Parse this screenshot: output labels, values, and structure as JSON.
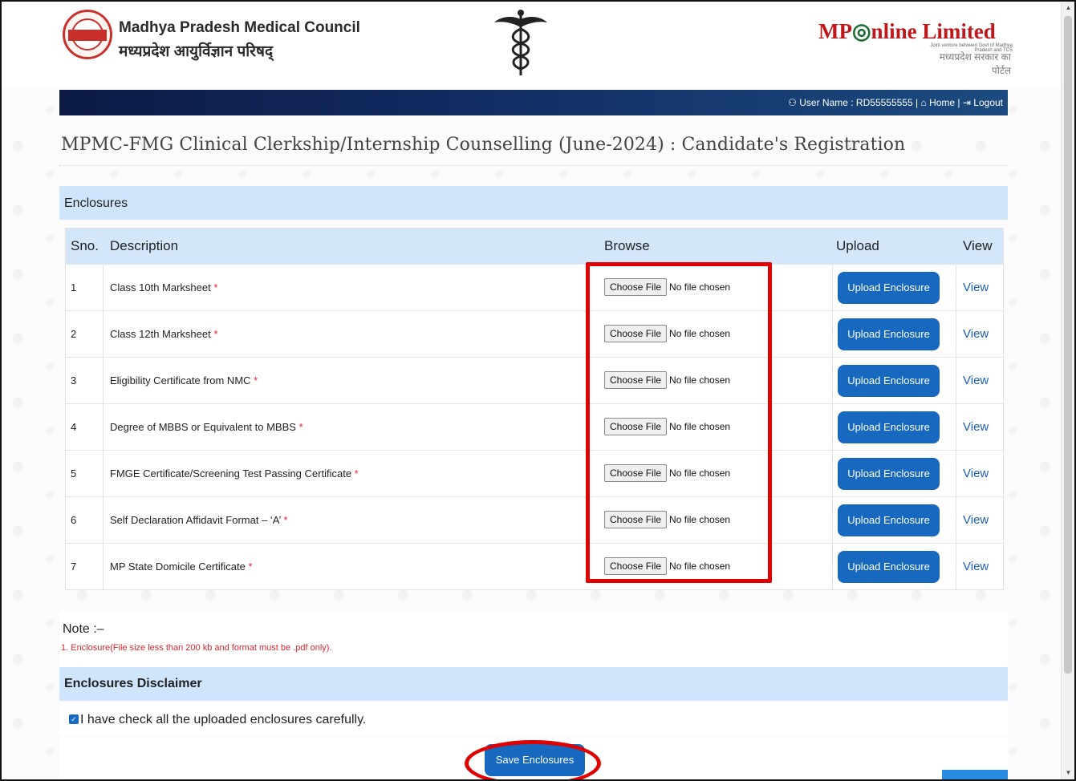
{
  "header": {
    "org_name_en": "Madhya Pradesh Medical Council",
    "org_name_hi": "मध्यप्रदेश आयुर्विज्ञान परिषद्",
    "seal_text": "mpmc",
    "partner_name": "MPOnline Limited",
    "partner_name_a": "MP",
    "partner_name_b": "nline Limited",
    "partner_tagline": "Joint venture between Govt of Madhya Pradesh and TCS",
    "partner_tagline_hi": "मध्यप्रदेश सरकार का पोर्टल"
  },
  "navbar": {
    "user_label": "User Name : RD55555555",
    "home_label": "Home",
    "logout_label": "Logout",
    "sep": "|"
  },
  "page_title": "MPMC-FMG Clinical Clerkship/Internship Counselling (June-2024) : Candidate's Registration",
  "enclosures": {
    "section_title": "Enclosures",
    "columns": {
      "sno": "Sno.",
      "description": "Description",
      "browse": "Browse",
      "upload": "Upload",
      "view": "View"
    },
    "choose_file_label": "Choose File",
    "no_file_label": "No file chosen",
    "upload_label": "Upload Enclosure",
    "view_label": "View",
    "required_mark": "*",
    "rows": [
      {
        "sno": "1",
        "description": "Class 10th Marksheet"
      },
      {
        "sno": "2",
        "description": "Class 12th Marksheet"
      },
      {
        "sno": "3",
        "description": "Eligibility Certificate from NMC"
      },
      {
        "sno": "4",
        "description": "Degree of MBBS or Equivalent to MBBS"
      },
      {
        "sno": "5",
        "description": "FMGE Certificate/Screening Test Passing Certificate"
      },
      {
        "sno": "6",
        "description": "Self Declaration Affidavit Format – ‘A’"
      },
      {
        "sno": "7",
        "description": "MP State Domicile Certificate"
      }
    ]
  },
  "note": {
    "label": "Note :–",
    "text": "1. Enclosure(File size less than 200 kb and format must be .pdf only)."
  },
  "disclaimer": {
    "title": "Enclosures Disclaimer",
    "checkbox_text": "I have check all the uploaded enclosures carefully.",
    "checked": true
  },
  "actions": {
    "save_label": "Save Enclosures"
  },
  "colors": {
    "primary_button": "#1769bf",
    "panel_header": "#cfe5fb",
    "highlight": "#e00000"
  }
}
